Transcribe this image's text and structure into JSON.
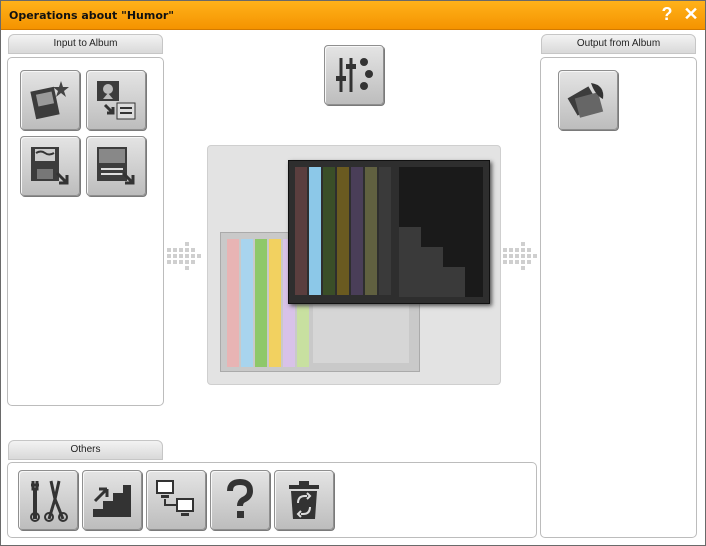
{
  "window": {
    "title": "Operations about \"Humor\"",
    "help_glyph": "?",
    "close_glyph": "✕"
  },
  "sections": {
    "input": "Input to Album",
    "output": "Output from Album",
    "others": "Others"
  },
  "input_buttons": [
    {
      "icon": "add-photo-star-icon"
    },
    {
      "icon": "import-image-icon"
    },
    {
      "icon": "import-floppy-icon"
    },
    {
      "icon": "import-document-icon"
    }
  ],
  "center_button": {
    "icon": "settings-sliders-icon"
  },
  "output_buttons": [
    {
      "icon": "export-photos-icon"
    }
  ],
  "other_buttons": [
    {
      "icon": "tools-icon"
    },
    {
      "icon": "stairs-upgrade-icon"
    },
    {
      "icon": "network-computers-icon"
    },
    {
      "icon": "help-question-icon"
    },
    {
      "icon": "recycle-bin-icon"
    }
  ],
  "colors": {
    "title_bar": "#f59300",
    "back_spines": [
      "#e8b4b4",
      "#a8d4ee",
      "#8ec86a",
      "#f2d160",
      "#d8c2e8",
      "#c8e0a0"
    ],
    "front_spines": [
      "#5a3e3e",
      "#8cc8e8",
      "#3a4e28",
      "#6a5a20",
      "#4a3e58",
      "#606040"
    ]
  }
}
